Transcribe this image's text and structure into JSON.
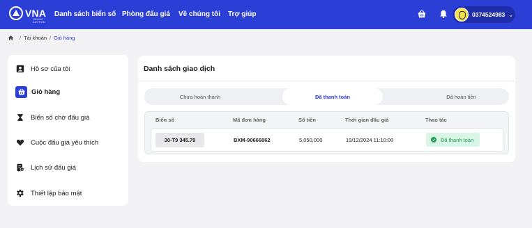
{
  "brand": {
    "name": "VNA",
    "tagline": "ONLINE AUCTION"
  },
  "nav": {
    "items": [
      "Danh sách biển số",
      "Phòng đấu giá",
      "Về chúng tôi",
      "Trợ giúp"
    ]
  },
  "header": {
    "basket_icon": "basket-icon",
    "bell_icon": "bell-icon",
    "phone": "0374524983"
  },
  "breadcrumb": {
    "items": [
      "Tài khoản",
      "Giỏ hàng"
    ]
  },
  "sidebar": {
    "items": [
      {
        "label": "Hồ sơ của tôi",
        "icon": "user-icon"
      },
      {
        "label": "Giỏ hàng",
        "icon": "basket-icon",
        "active": true
      },
      {
        "label": "Biển số chờ đấu giá",
        "icon": "hourglass-icon"
      },
      {
        "label": "Cuộc đấu giá yêu thích",
        "icon": "heart-icon"
      },
      {
        "label": "Lịch sử đấu giá",
        "icon": "history-icon"
      },
      {
        "label": "Thiết lập bảo mật",
        "icon": "gear-icon"
      }
    ]
  },
  "main": {
    "title": "Danh sách giao dịch",
    "tabs": [
      {
        "label": "Chưa hoàn thành",
        "active": false
      },
      {
        "label": "Đã thanh toán",
        "active": true
      },
      {
        "label": "Đã hoàn tiền",
        "active": false
      }
    ],
    "table": {
      "columns": [
        "Biển số",
        "Mã đơn hàng",
        "Số tiền",
        "Thời gian đấu giá",
        "Thao tác"
      ],
      "rows": [
        {
          "plate": "30-T9 345.79",
          "order": "BXM-90666862",
          "amount": "5,050,000",
          "time": "19/12/2024 11:10:00",
          "status": "Đã thanh toán"
        }
      ]
    }
  },
  "colors": {
    "brand": "#2b3ed6",
    "status_bg": "#d9f5e6",
    "status_text": "#1f9a57"
  }
}
